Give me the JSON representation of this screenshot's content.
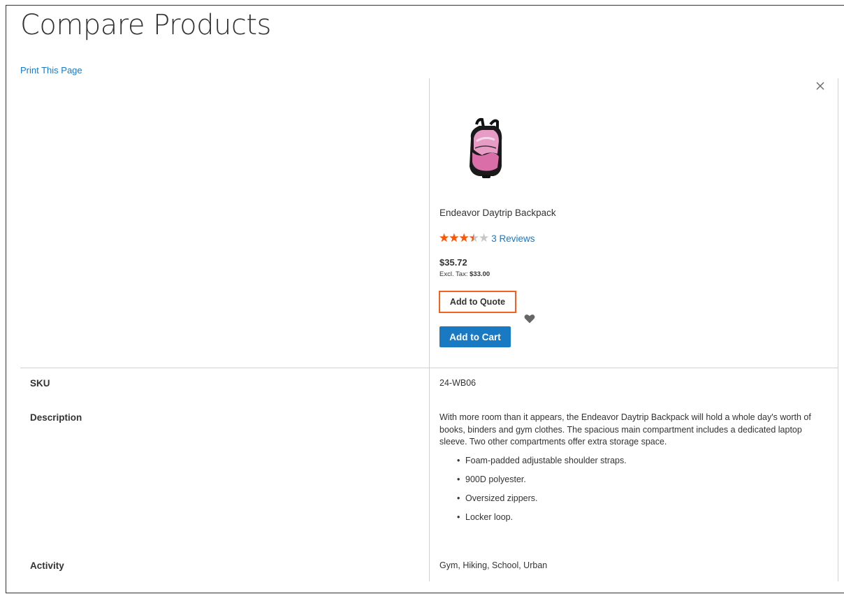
{
  "page": {
    "title": "Compare Products",
    "print_link": "Print This Page"
  },
  "product": {
    "name": "Endeavor Daytrip Backpack",
    "rating_fraction": 0.7,
    "reviews_label": "3 Reviews",
    "price": "$35.72",
    "excl_tax_label": "Excl. Tax:",
    "excl_tax_value": "$33.00",
    "add_to_quote_label": "Add to Quote",
    "add_to_cart_label": "Add to Cart",
    "remove_icon": "close-icon",
    "wishlist_icon": "heart-icon"
  },
  "attributes": {
    "sku": {
      "label": "SKU",
      "value": "24-WB06"
    },
    "description": {
      "label": "Description",
      "text": "With more room than it appears, the Endeavor Daytrip Backpack will hold a whole day's worth of books, binders and gym clothes. The spacious main compartment includes a dedicated laptop sleeve. Two other compartments offer extra storage space.",
      "bullets": [
        "Foam-padded adjustable shoulder straps.",
        "900D polyester.",
        "Oversized zippers.",
        "Locker loop."
      ]
    },
    "activity": {
      "label": "Activity",
      "value": "Gym, Hiking, School, Urban"
    }
  },
  "colors": {
    "link": "#1979c3",
    "star": "#ff5501",
    "quote_border": "#f26322",
    "cart_bg": "#1979c3"
  }
}
